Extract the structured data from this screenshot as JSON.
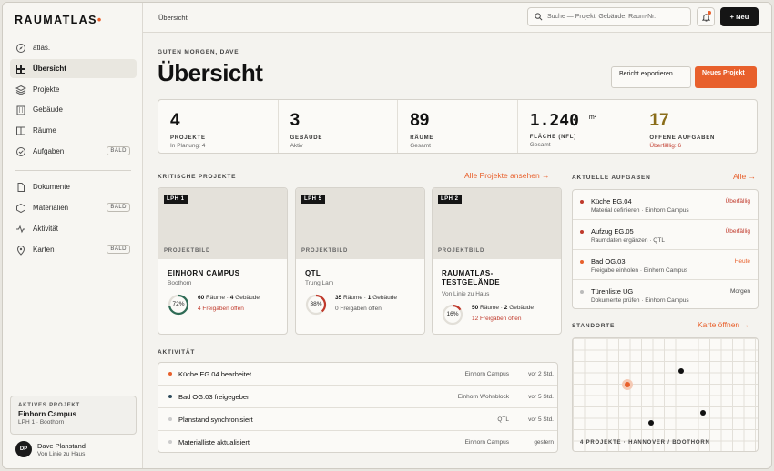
{
  "app": {
    "logo": "RAUMATLAS",
    "logo_dot": "•"
  },
  "colors": {
    "accent": "#e8602c",
    "dark": "#151515",
    "ring_green": "#2e6b55",
    "ring_red": "#c0392b",
    "warn": "#c0392b",
    "highlight": "#8a6d1a"
  },
  "sidebar": {
    "items": [
      {
        "label": "atlas.",
        "icon": "compass-icon"
      },
      {
        "label": "Übersicht",
        "icon": "grid-icon",
        "active": true
      },
      {
        "label": "Projekte",
        "icon": "layers-icon"
      },
      {
        "label": "Gebäude",
        "icon": "building-icon"
      },
      {
        "label": "Räume",
        "icon": "room-icon"
      },
      {
        "label": "Aufgaben",
        "icon": "check-circle-icon",
        "badge": "BALD"
      },
      {
        "label": "Dokumente",
        "icon": "document-icon"
      },
      {
        "label": "Materialien",
        "icon": "material-icon",
        "badge": "BALD"
      },
      {
        "label": "Aktivität",
        "icon": "activity-icon"
      },
      {
        "label": "Karten",
        "icon": "map-pin-icon",
        "badge": "BALD"
      }
    ],
    "active_project": {
      "label": "AKTIVES PROJEKT",
      "name": "Einhorn Campus",
      "sub": "LPH 1 · Boothorn"
    },
    "user": {
      "initials": "DP",
      "name": "Dave Planstand",
      "sub": "Von Linie zu Haus"
    }
  },
  "topbar": {
    "breadcrumb": "Übersicht",
    "search_placeholder": "Suche — Projekt, Gebäude, Raum-Nr.",
    "new_button": "+ Neu"
  },
  "header": {
    "greeting": "GUTEN MORGEN, DAVE",
    "title": "Übersicht",
    "export_button": "Bericht exportieren",
    "new_project_button": "Neues Projekt"
  },
  "stats": [
    {
      "value": "4",
      "label": "PROJEKTE",
      "sub": "In Planung: 4"
    },
    {
      "value": "3",
      "label": "GEBÄUDE",
      "sub": "Aktiv"
    },
    {
      "value": "89",
      "label": "RÄUME",
      "sub": "Gesamt"
    },
    {
      "value": "1.240",
      "unit": "m²",
      "label": "FLÄCHE (NFL)",
      "sub": "Gesamt"
    },
    {
      "value": "17",
      "label": "OFFENE AUFGABEN",
      "sub": "Überfällig: 6"
    }
  ],
  "critical": {
    "title": "KRITISCHE PROJEKTE",
    "link": "Alle Projekte ansehen →",
    "image_label": "PROJEKTBILD",
    "projects": [
      {
        "phase": "LPH 1",
        "name": "EINHORN CAMPUS",
        "owner": "Boothorn",
        "progress": 72,
        "progress_label": "72%",
        "rooms": "60",
        "rooms_label": "Räume ·",
        "buildings": "4",
        "buildings_label": "Gebäude",
        "approvals": "4 Freigaben offen",
        "approvals_alert": true
      },
      {
        "phase": "LPH 5",
        "name": "QTL",
        "owner": "Trung Lam",
        "progress": 38,
        "progress_label": "38%",
        "rooms": "35",
        "rooms_label": "Räume ·",
        "buildings": "1",
        "buildings_label": "Gebäude",
        "approvals": "0 Freigaben offen",
        "approvals_alert": false
      },
      {
        "phase": "LPH 2",
        "name": "RAUMATLAS-TESTGELÄNDE",
        "owner": "Von Linie zu Haus",
        "progress": 16,
        "progress_label": "16%",
        "rooms": "50",
        "rooms_label": "Räume ·",
        "buildings": "2",
        "buildings_label": "Gebäude",
        "approvals": "12 Freigaben offen",
        "approvals_alert": true
      }
    ]
  },
  "tasks": {
    "title": "AKTUELLE AUFGABEN",
    "link": "Alle →",
    "items": [
      {
        "name": "Küche EG.04",
        "sub": "Material definieren · Einhorn Campus",
        "badge": "Überfällig",
        "status": "overdue"
      },
      {
        "name": "Aufzug EG.05",
        "sub": "Raumdaten ergänzen · QTL",
        "badge": "Überfällig",
        "status": "overdue"
      },
      {
        "name": "Bad OG.03",
        "sub": "Freigabe einholen · Einhorn Campus",
        "badge": "Heute",
        "status": "today"
      },
      {
        "name": "Türenliste UG",
        "sub": "Dokumente prüfen · Einhorn Campus",
        "badge": "Morgen",
        "status": "later"
      }
    ]
  },
  "map": {
    "title": "STANDORTE",
    "link": "Karte öffnen →",
    "label": "4 PROJEKTE · HANNOVER / BOOTHORN"
  },
  "activity": {
    "title": "AKTIVITÄT",
    "items": [
      {
        "text": "Küche EG.04 bearbeitet",
        "project": "Einhorn Campus",
        "time": "vor 2 Std.",
        "dot": "accent"
      },
      {
        "text": "Bad OG.03 freigegeben",
        "project": "Einhorn Wohnblock",
        "time": "vor 5 Std.",
        "dot": "dark"
      },
      {
        "text": "Planstand synchronisiert",
        "project": "QTL",
        "time": "vor 5 Std.",
        "dot": "muted"
      },
      {
        "text": "Materialliste aktualisiert",
        "project": "Einhorn Campus",
        "time": "gestern",
        "dot": "muted"
      }
    ]
  }
}
